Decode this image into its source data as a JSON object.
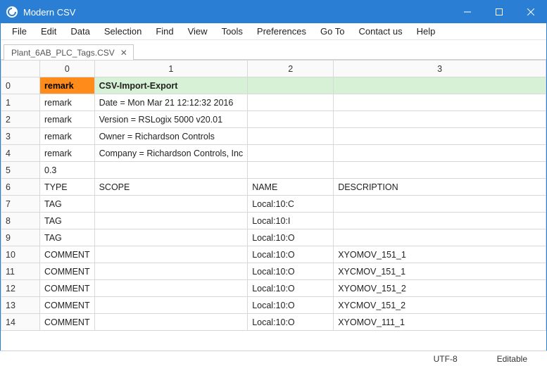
{
  "window": {
    "title": "Modern CSV"
  },
  "menu": [
    "File",
    "Edit",
    "Data",
    "Selection",
    "Find",
    "View",
    "Tools",
    "Preferences",
    "Go To",
    "Contact us",
    "Help"
  ],
  "tab": {
    "name": "Plant_6AB_PLC_Tags.CSV"
  },
  "columns": [
    "0",
    "1",
    "2",
    "3"
  ],
  "rows": [
    {
      "n": "0",
      "c": [
        "remark",
        "CSV-Import-Export",
        "",
        ""
      ],
      "hl": true
    },
    {
      "n": "1",
      "c": [
        "remark",
        "Date = Mon Mar 21 12:12:32 2016",
        "",
        ""
      ]
    },
    {
      "n": "2",
      "c": [
        "remark",
        "Version = RSLogix 5000 v20.01",
        "",
        ""
      ]
    },
    {
      "n": "3",
      "c": [
        "remark",
        "Owner = Richardson Controls",
        "",
        ""
      ]
    },
    {
      "n": "4",
      "c": [
        "remark",
        "Company = Richardson Controls, Inc",
        "",
        ""
      ]
    },
    {
      "n": "5",
      "c": [
        "0.3",
        "",
        "",
        ""
      ]
    },
    {
      "n": "6",
      "c": [
        "TYPE",
        "SCOPE",
        "NAME",
        "DESCRIPTION"
      ]
    },
    {
      "n": "7",
      "c": [
        "TAG",
        "",
        "Local:10:C",
        ""
      ]
    },
    {
      "n": "8",
      "c": [
        "TAG",
        "",
        "Local:10:I",
        ""
      ]
    },
    {
      "n": "9",
      "c": [
        "TAG",
        "",
        "Local:10:O",
        ""
      ]
    },
    {
      "n": "10",
      "c": [
        "COMMENT",
        "",
        "Local:10:O",
        "XYOMOV_151_1"
      ]
    },
    {
      "n": "11",
      "c": [
        "COMMENT",
        "",
        "Local:10:O",
        "XYCMOV_151_1"
      ]
    },
    {
      "n": "12",
      "c": [
        "COMMENT",
        "",
        "Local:10:O",
        "XYOMOV_151_2"
      ]
    },
    {
      "n": "13",
      "c": [
        "COMMENT",
        "",
        "Local:10:O",
        "XYCMOV_151_2"
      ]
    },
    {
      "n": "14",
      "c": [
        "COMMENT",
        "",
        "Local:10:O",
        "XYOMOV_111_1"
      ]
    }
  ],
  "status": {
    "encoding": "UTF-8",
    "mode": "Editable"
  }
}
